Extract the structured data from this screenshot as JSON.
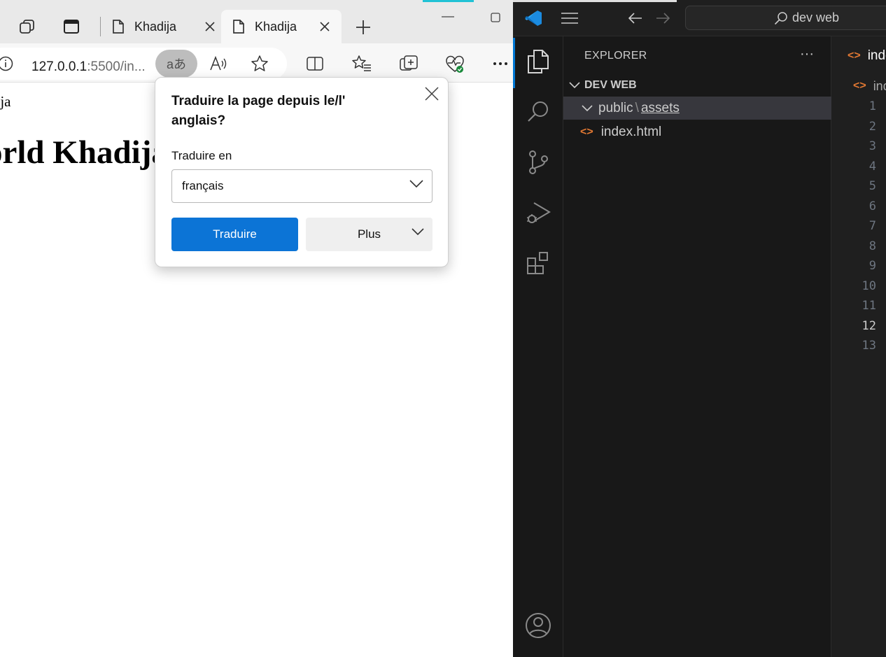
{
  "browser": {
    "tabs": [
      {
        "label": "Khadija"
      },
      {
        "label": "Khadija"
      }
    ],
    "address": {
      "host": "127.0.0.1",
      "rest": ":5500/in..."
    },
    "translate_glyph": "aあ",
    "page": {
      "small_text": "dija",
      "heading": "orld Khadija"
    },
    "translate_popup": {
      "title": "Traduire la page depuis le/l' anglais?",
      "translate_to_label": "Traduire en",
      "language_selected": "français",
      "translate_button": "Traduire",
      "more_button": "Plus"
    }
  },
  "vscode": {
    "command_center": "dev web",
    "explorer": {
      "title": "EXPLORER",
      "more": "···",
      "folder": "DEV WEB",
      "items": [
        {
          "label": "public",
          "sub": "assets"
        },
        {
          "label": "index.html"
        }
      ]
    },
    "editor": {
      "tab_label": "index.html",
      "breadcrumb": "index.html",
      "line_numbers": [
        "1",
        "2",
        "3",
        "4",
        "5",
        "6",
        "7",
        "8",
        "9",
        "10",
        "11",
        "12",
        "13"
      ],
      "current_line": "12"
    }
  },
  "colors": {
    "edge_blue": "#0c74d6",
    "vscode_bg": "#1f1f1f",
    "html_orange": "#e37933",
    "activity_accent": "#0078d4"
  }
}
